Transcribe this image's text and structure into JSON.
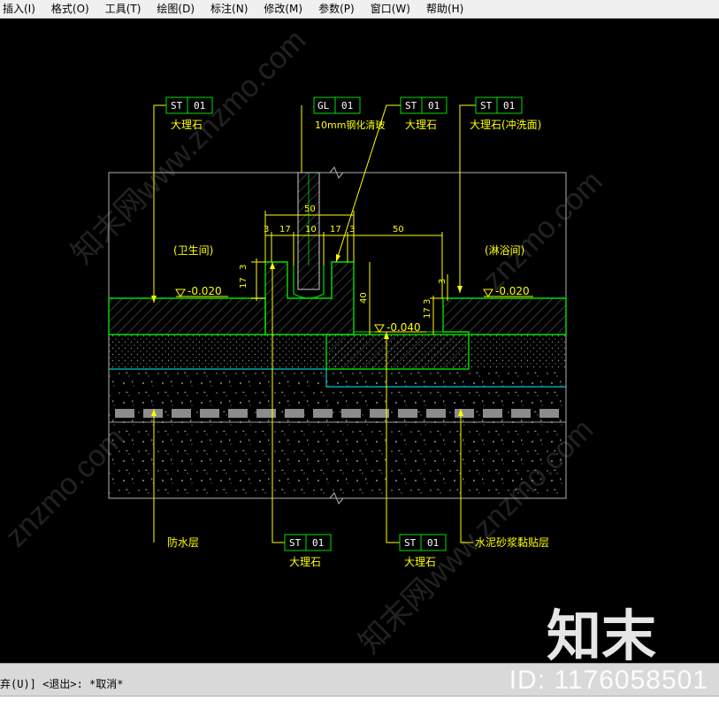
{
  "menu": [
    "插入(I)",
    "格式(O)",
    "工具(T)",
    "绘图(D)",
    "标注(N)",
    "修改(M)",
    "参数(P)",
    "窗口(W)",
    "帮助(H)"
  ],
  "tags": [
    {
      "code": "ST",
      "num": "01",
      "label": "大理石"
    },
    {
      "code": "GL",
      "num": "01",
      "label": "10mm钢化清玻"
    },
    {
      "code": "ST",
      "num": "01",
      "label": "大理石"
    },
    {
      "code": "ST",
      "num": "01",
      "label": "大理石(冲洗面)"
    },
    {
      "code": "ST",
      "num": "01",
      "label": "大理石"
    },
    {
      "code": "ST",
      "num": "01",
      "label": "大理石"
    }
  ],
  "rooms": {
    "left": "(卫生间)",
    "right": "(淋浴间)"
  },
  "levels": {
    "left": "-0.020",
    "right": "-0.020",
    "center": "-0.040"
  },
  "layers": {
    "waterproof": "防水层",
    "mortar": "水泥砂浆黏贴层"
  },
  "dims": {
    "top_50": "50",
    "row": [
      "3",
      "17",
      "10",
      "17",
      "3"
    ],
    "right_50": "50",
    "left_3": "3",
    "left_17": "17",
    "depth_40": "40",
    "right_3": "3",
    "right_17": "17",
    "right_top_3": "3"
  },
  "command": {
    "text": "弃(U)] <退出>: *取消*"
  },
  "watermark": {
    "logo": "知末",
    "id": "ID: 1176058501",
    "site": "znzmo.com",
    "site_cn": "知末网www.znzmo.com"
  }
}
